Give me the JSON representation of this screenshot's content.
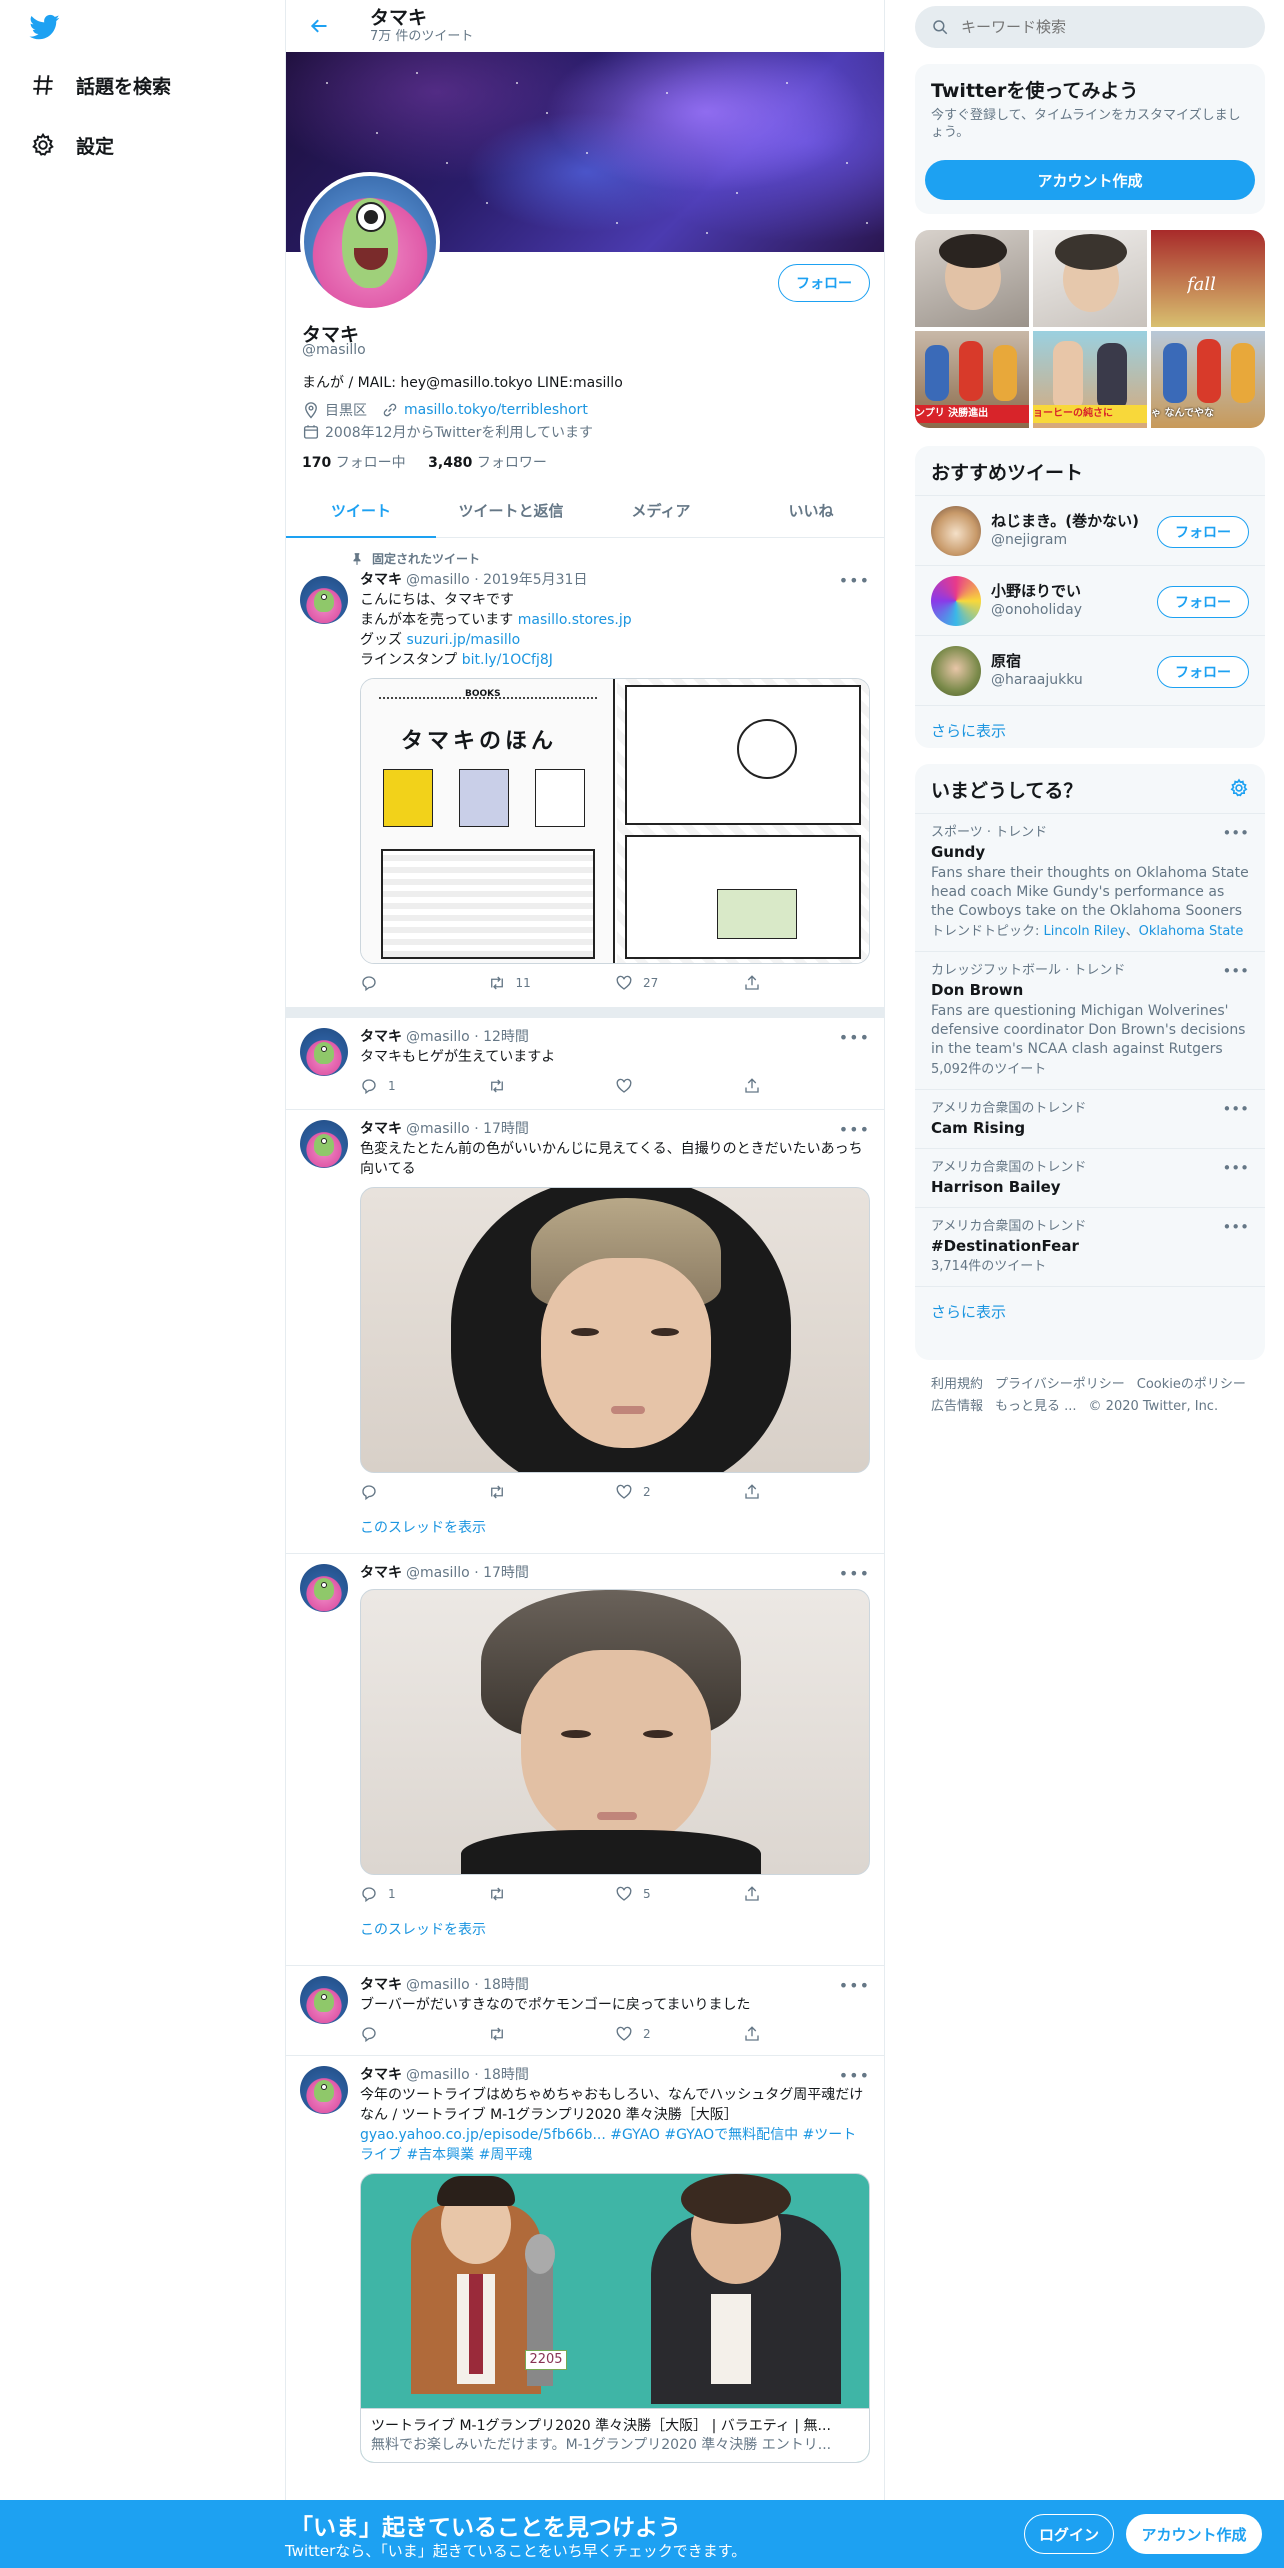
{
  "nav": {
    "explore_label": "話題を検索",
    "settings_label": "設定"
  },
  "header": {
    "title": "タマキ",
    "subtitle": "7万 件のツイート"
  },
  "profile": {
    "name": "タマキ",
    "handle": "@masillo",
    "bio": "まんが / MAIL: hey@masillo.tokyo LINE:masillo",
    "location": "目黒区",
    "url": "masillo.tokyo/terribleshort",
    "joined": "2008年12月からTwitterを利用しています",
    "following_count": "170",
    "following_label": "フォロー中",
    "followers_count": "3,480",
    "followers_label": "フォロワー",
    "follow_button": "フォロー"
  },
  "tabs": [
    {
      "label": "ツイート"
    },
    {
      "label": "ツイートと返信"
    },
    {
      "label": "メディア"
    },
    {
      "label": "いいね"
    }
  ],
  "pinned_label": "固定されたツイート",
  "show_thread": "このスレッドを表示",
  "tweets": [
    {
      "name": "タマキ",
      "handle": "@masillo",
      "time": "2019年5月31日",
      "line1": "こんにちは、タマキです",
      "line2_text": "まんが本を売っています ",
      "line2_link": "masillo.stores.jp",
      "line3_text": "グッズ ",
      "line3_link": "suzuri.jp/masillo",
      "line4_text": "ラインスタンプ ",
      "line4_link": "bit.ly/1OCfj8J",
      "media_title": "タマキのほん",
      "media_badge": "BOOKS",
      "reply": "",
      "retweet": "11",
      "like": "27"
    },
    {
      "name": "タマキ",
      "handle": "@masillo",
      "time": "12時間",
      "text": "タマキもヒゲが生えていますよ",
      "reply": "1",
      "retweet": "",
      "like": ""
    },
    {
      "name": "タマキ",
      "handle": "@masillo",
      "time": "17時間",
      "text": "色変えたとたん前の色がいいかんじに見えてくる、自撮りのときだいたいあっち向いてる",
      "reply": "",
      "retweet": "",
      "like": "2"
    },
    {
      "name": "タマキ",
      "handle": "@masillo",
      "time": "17時間",
      "reply": "1",
      "retweet": "",
      "like": "5"
    },
    {
      "name": "タマキ",
      "handle": "@masillo",
      "time": "18時間",
      "text": "ブーバーがだいすきなのでポケモンゴーに戻ってまいりました",
      "reply": "",
      "retweet": "",
      "like": "2"
    },
    {
      "name": "タマキ",
      "handle": "@masillo",
      "time": "18時間",
      "text": "今年のツートライブはめちゃめちゃおもしろい、なんでハッシュタグ周平魂だけなん / ツートライブ M-1グランプリ2020 準々決勝［大阪］",
      "links": "gyao.yahoo.co.jp/episode/5fb66b... #GYAO #GYAOで無料配信中 #ツートライブ #吉本興業 #周平魂",
      "card_title": "ツートライブ M-1グランプリ2020 準々決勝［大阪］ | バラエティ | 無...",
      "card_desc": "無料でお楽しみいただけます。M-1グランプリ2020 準々決勝 エントリ...",
      "badge": "2205"
    }
  ],
  "search": {
    "placeholder": "キーワード検索"
  },
  "signup_card": {
    "title": "Twitterを使ってみよう",
    "desc": "今すぐ登録して、タイムラインをカスタマイズしましょう。",
    "button": "アカウント作成"
  },
  "photo_captions": [
    "fall",
    "ンプリ 決勝進出",
    "ョーヒーの純さに",
    "ゃ なんでやな"
  ],
  "recommended": {
    "title": "おすすめツイート",
    "users": [
      {
        "name": "ねじまき。(巻かない)",
        "handle": "@nejigram"
      },
      {
        "name": "小野ほりでい",
        "handle": "@onoholiday"
      },
      {
        "name": "原宿",
        "handle": "@haraajukku"
      }
    ],
    "follow_label": "フォロー",
    "more": "さらに表示"
  },
  "trends": {
    "title": "いまどうしてる？",
    "items": [
      {
        "cat": "スポーツ · トレンド",
        "name": "Gundy",
        "desc": "Fans share their thoughts on Oklahoma State head coach Mike Gundy's performance as the Cowboys take on the Oklahoma Sooners",
        "topic_label": "トレンドトピック: ",
        "topic1": "Lincoln Riley",
        "topic_sep": "、",
        "topic2": "Oklahoma State"
      },
      {
        "cat": "カレッジフットボール · トレンド",
        "name": "Don Brown",
        "desc": "Fans are questioning Michigan Wolverines' defensive coordinator Don Brown's decisions in the team's NCAA clash against Rutgers",
        "count": "5,092件のツイート"
      },
      {
        "cat": "アメリカ合衆国のトレンド",
        "name": "Cam Rising"
      },
      {
        "cat": "アメリカ合衆国のトレンド",
        "name": "Harrison Bailey"
      },
      {
        "cat": "アメリカ合衆国のトレンド",
        "name": "#DestinationFear",
        "count": "3,714件のツイート"
      }
    ],
    "more": "さらに表示"
  },
  "footer": {
    "terms": "利用規約",
    "privacy": "プライバシーポリシー",
    "cookie": "Cookieのポリシー",
    "ads": "広告情報",
    "more": "もっと見る ...",
    "copyright": "© 2020 Twitter, Inc."
  },
  "bottom_bar": {
    "title": "「いま」起きていることを見つけよう",
    "subtitle": "Twitterなら、「いま」起きていることをいち早くチェックできます。",
    "login": "ログイン",
    "signup": "アカウント作成"
  },
  "colors": {
    "accent": "#1da1f2",
    "link": "#1b95e0",
    "muted": "#657786"
  }
}
